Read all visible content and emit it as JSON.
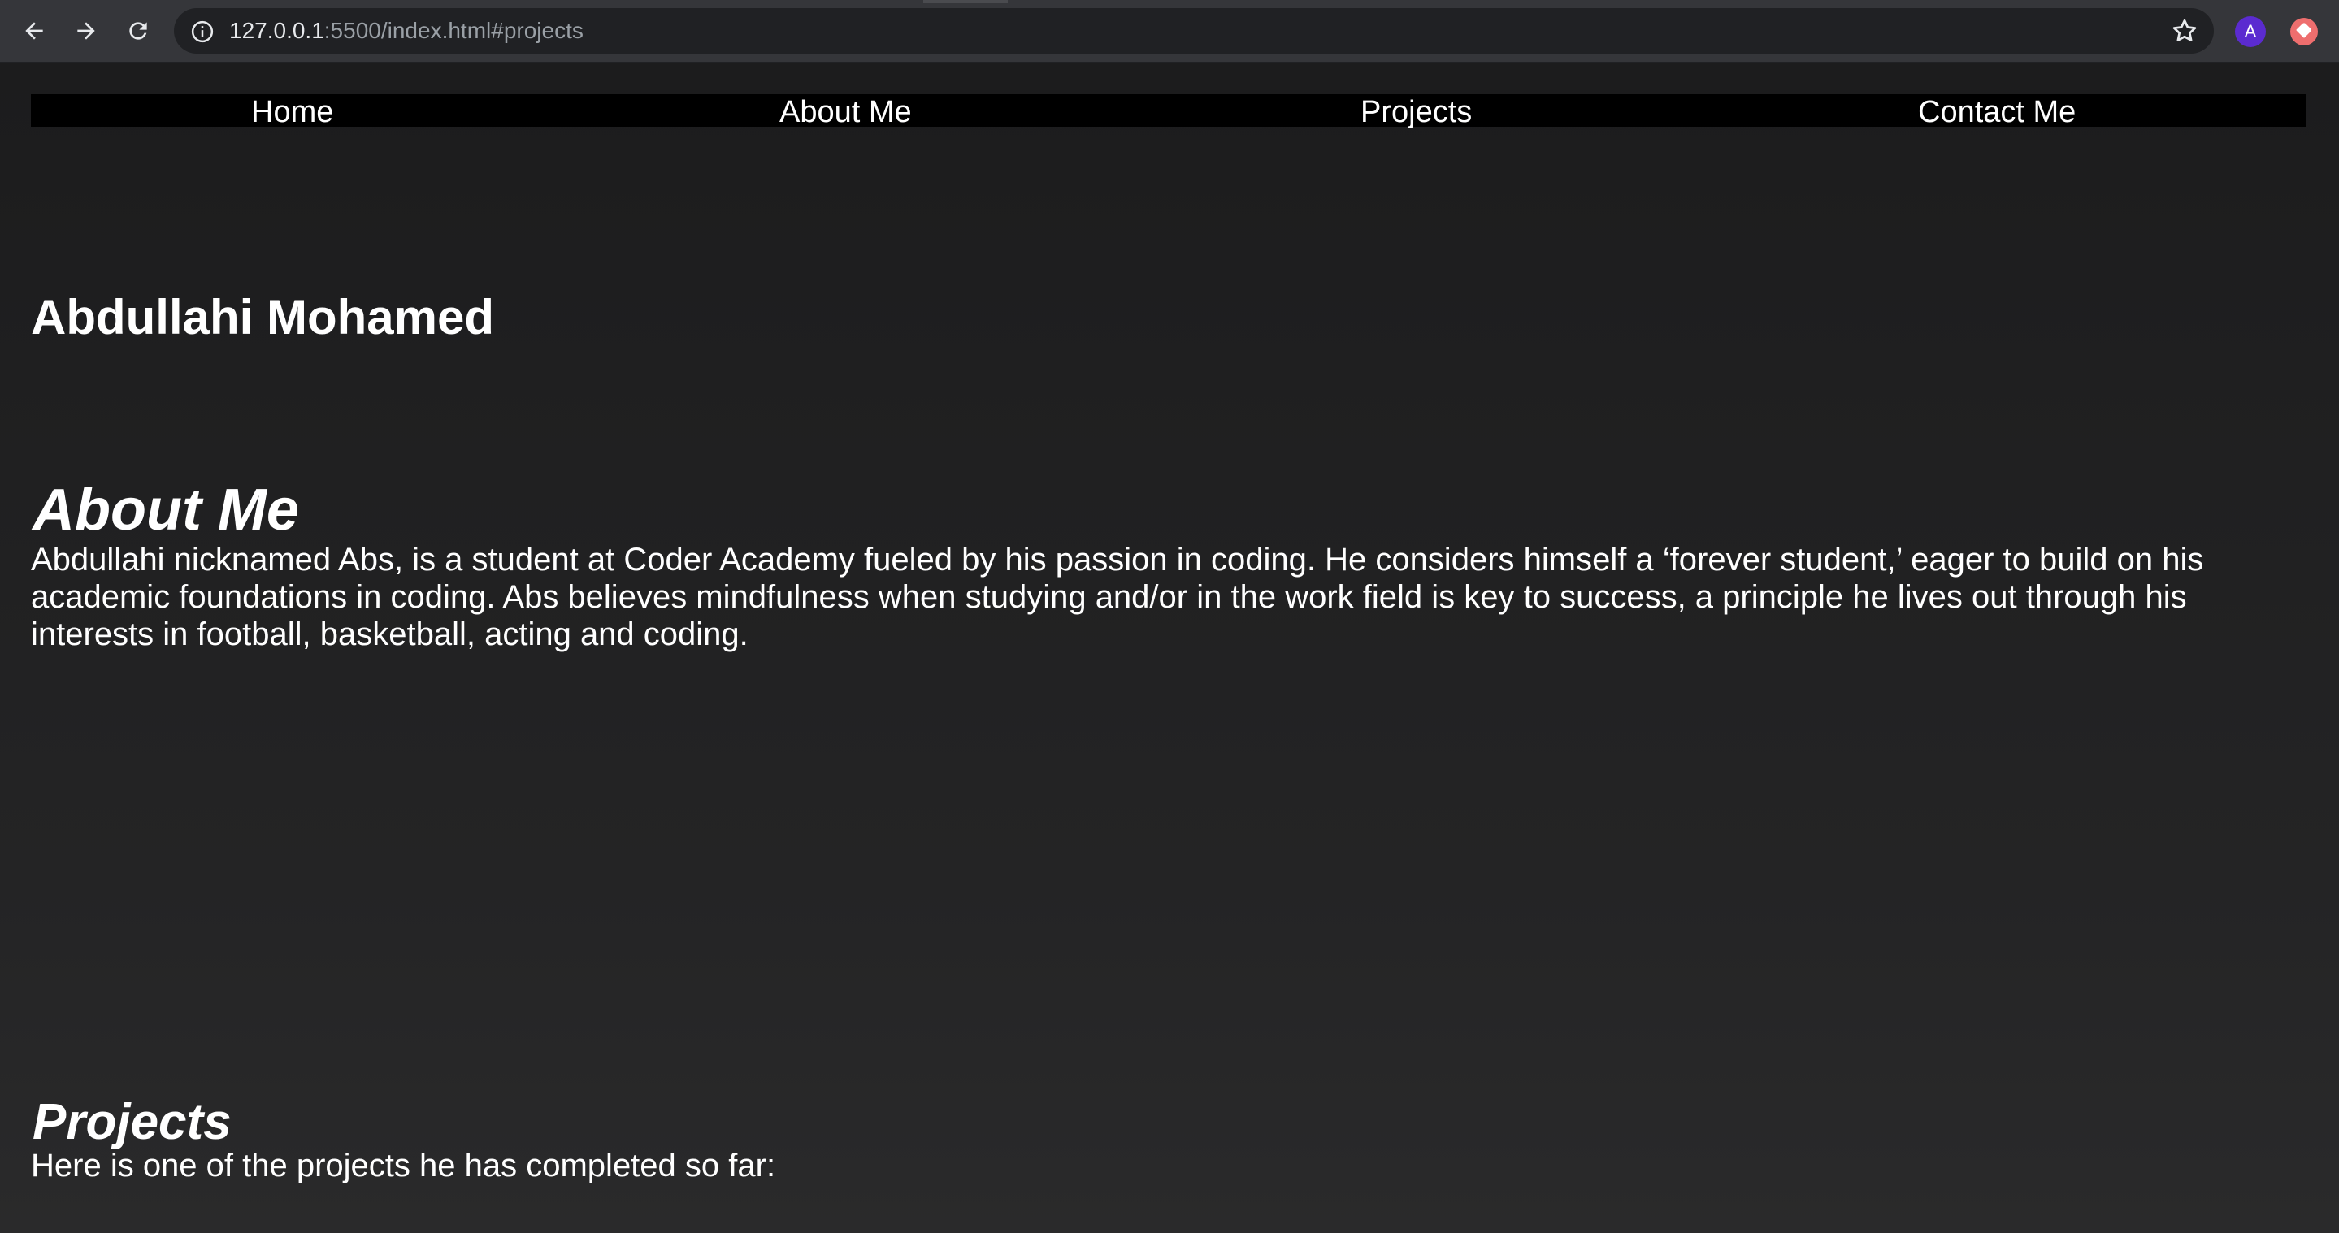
{
  "browser": {
    "url_host": "127.0.0.1",
    "url_rest": ":5500/index.html#projects",
    "profile_initial": "A",
    "icons": [
      "back-icon",
      "forward-icon",
      "reload-icon",
      "info-icon",
      "star-icon",
      "extension-icon"
    ],
    "colors": {
      "chrome": "#35363a",
      "omnibox": "#202124",
      "avatar": "#5b2bd0",
      "extension": "#ee6e6e"
    }
  },
  "nav": {
    "items": [
      {
        "label": "Home"
      },
      {
        "label": "About Me"
      },
      {
        "label": "Projects"
      },
      {
        "label": "Contact Me"
      }
    ]
  },
  "page": {
    "name": "Abdullahi Mohamed",
    "about": {
      "heading": "About Me",
      "text": "Abdullahi nicknamed Abs, is a student at Coder Academy fueled by his passion in coding. He considers himself a ‘forever student,’ eager to build on his academic foundations in coding. Abs believes mindfulness when studying and/or in the work field is key to success, a principle he lives out through his interests in football, basketball, acting and coding."
    },
    "projects": {
      "heading": "Projects",
      "text": "Here is one of the projects he has completed so far:"
    },
    "colors": {
      "background": "#1e1e1f",
      "navbar": "#000000",
      "text": "#ffffff"
    }
  }
}
